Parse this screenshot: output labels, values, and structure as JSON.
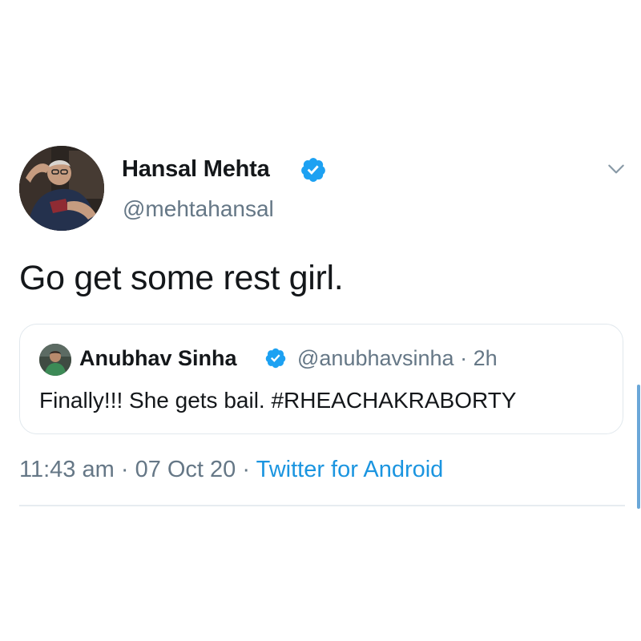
{
  "tweet": {
    "author": {
      "display_name": "Hansal Mehta",
      "handle": "@mehtahansal",
      "verified": true,
      "avatar_icon": "user-avatar"
    },
    "text": "Go get some rest girl.",
    "menu_icon": "chevron-down-icon",
    "quoted_tweet": {
      "author": {
        "display_name": "Anubhav Sinha",
        "handle": "@anubhavsinha",
        "verified": true,
        "avatar_icon": "user-avatar"
      },
      "separator": "·",
      "time_ago": "2h",
      "text": "Finally!!! She gets bail. #RHEACHAKRABORTY"
    },
    "timestamp": {
      "time": "11:43 am",
      "date": "07 Oct 20",
      "separator": "·",
      "source": "Twitter for Android"
    }
  },
  "colors": {
    "text_primary": "#14171a",
    "text_secondary": "#657786",
    "link": "#1b95e0",
    "verified": "#1da1f2",
    "border": "#e1e8ed"
  }
}
